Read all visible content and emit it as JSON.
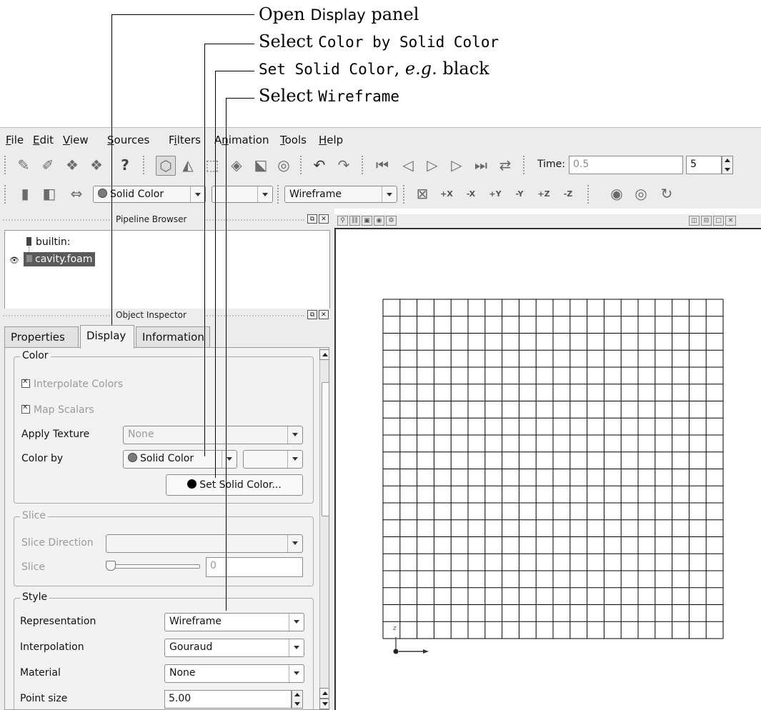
{
  "annotations": {
    "step1": {
      "pre": "Open ",
      "ui": "Display",
      "post": " panel"
    },
    "step2": {
      "pre": "Select ",
      "code": "Color by Solid Color"
    },
    "step3": {
      "code": "Set Solid Color",
      "mid": ", ",
      "italic": "e.g.",
      "post": " black"
    },
    "step4": {
      "pre": "Select ",
      "code": "Wireframe"
    }
  },
  "menubar": [
    {
      "u": "F",
      "rest": "ile"
    },
    {
      "u": "E",
      "rest": "dit"
    },
    {
      "u": "V",
      "rest": "iew"
    },
    {
      "u": "S",
      "rest": "ources"
    },
    {
      "pre": "F",
      "u": "i",
      "rest": "lters"
    },
    {
      "pre": "A",
      "u": "n",
      "rest": "imation"
    },
    {
      "u": "T",
      "rest": "ools"
    },
    {
      "u": "H",
      "rest": "elp"
    }
  ],
  "toolbar1": {
    "time_label": "Time:",
    "time_value": "0.5",
    "timestep_value": "5"
  },
  "toolbar2": {
    "color_by_value": "Solid Color",
    "component_value": "",
    "representation_value": "Wireframe",
    "axis_buttons": [
      "+X",
      "-X",
      "+Y",
      "-Y",
      "+Z",
      "-Z"
    ]
  },
  "pipeline_browser": {
    "title": "Pipeline Browser",
    "items": [
      "builtin:",
      "cavity.foam"
    ]
  },
  "object_inspector": {
    "title": "Object Inspector",
    "tabs": [
      "Properties",
      "Display",
      "Information"
    ],
    "active_tab": "Display",
    "color_group": {
      "title": "Color",
      "interpolate_colors": "Interpolate Colors",
      "map_scalars": "Map Scalars",
      "apply_texture_label": "Apply Texture",
      "apply_texture_value": "None",
      "color_by_label": "Color by",
      "color_by_value": "Solid Color",
      "component_value": "",
      "set_solid_color_button": "Set Solid Color..."
    },
    "slice_group": {
      "title": "Slice",
      "slice_direction_label": "Slice Direction",
      "slice_direction_value": "",
      "slice_label": "Slice",
      "slice_value": "0"
    },
    "style_group": {
      "title": "Style",
      "representation_label": "Representation",
      "representation_value": "Wireframe",
      "interpolation_label": "Interpolation",
      "interpolation_value": "Gouraud",
      "material_label": "Material",
      "material_value": "None",
      "point_size_label": "Point size",
      "point_size_value": "5.00"
    }
  },
  "render_view": {
    "mesh_rows": 20,
    "mesh_cols": 20,
    "axes_label": "z"
  },
  "colors": {
    "chrome": "#ececec",
    "selection": "#5a5a5a",
    "mesh": "#000000"
  }
}
